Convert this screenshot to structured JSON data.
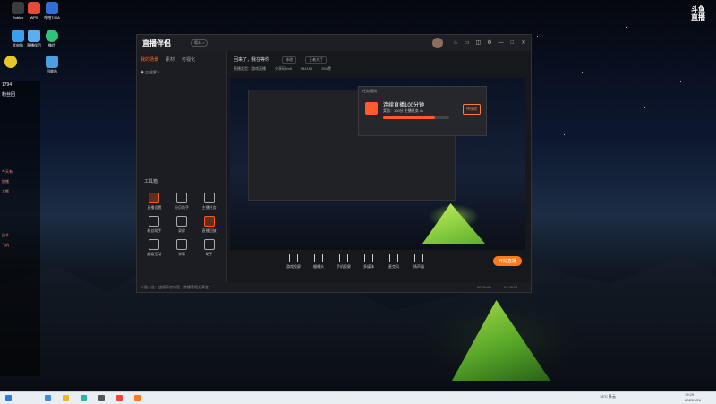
{
  "desktop": {
    "icons_left": [
      {
        "label": "Roblox"
      },
      {
        "label": "WPS"
      },
      {
        "label": "哈哈T40A"
      },
      {
        "label": "此电脑"
      },
      {
        "label": "直播伴侣"
      },
      {
        "label": ""
      },
      {
        "label": ""
      },
      {
        "label": ""
      },
      {
        "label": "微信"
      },
      {
        "label": "回收站"
      }
    ],
    "brand_corner": "斗鱼\n直播"
  },
  "chat_strip": {
    "count": "1794",
    "header": "粉丝团",
    "lines": [
      "今天有",
      "猪猪",
      "大熊",
      "白羊",
      "",
      "飞机"
    ]
  },
  "window": {
    "brand": "直播伴侣",
    "brand_tag": "版本 >",
    "titlebar_buttons": [
      "⌂",
      "▭",
      "◫",
      "⚙",
      "—",
      "□",
      "✕"
    ],
    "left_tabs": [
      "我的场景",
      "素材",
      "可视化"
    ],
    "scene_item": "全屏 1",
    "tools_title": "工具箱",
    "tools": [
      {
        "label": "直播设置",
        "red": true
      },
      {
        "label": "分贝助手",
        "red": false
      },
      {
        "label": "主播任务",
        "red": false
      },
      {
        "label": "粉丝助手",
        "red": false
      },
      {
        "label": "录屏",
        "red": false
      },
      {
        "label": "直播回放",
        "red": true
      },
      {
        "label": "超级互动",
        "red": false
      },
      {
        "label": "弹幕",
        "red": false
      },
      {
        "label": "助手",
        "red": false
      },
      {
        "label": "",
        "red": false
      },
      {
        "label": "",
        "red": false
      },
      {
        "label": "",
        "red": false
      }
    ],
    "room_name": "回来了，我在等你",
    "room_btn1": "修改",
    "room_btn2": "王者大厅",
    "meta": [
      "直播类型：游戏直播",
      "分享码:rb8",
      "984156",
      "394赞"
    ],
    "popup": {
      "header": "任务通知",
      "title": "连续直播100分钟",
      "subtitle": "奖励：100分 主播任务 x1",
      "button": "待领取",
      "progress": 0.78
    },
    "controls": [
      "游戏投屏",
      "摄像头",
      "手机投屏",
      "多媒体",
      "麦克风",
      "扬声器"
    ],
    "start_button": "开始直播",
    "status": {
      "tip": "斗鱼公告：违规不良内容，禁播等相关事宜...",
      "time1": "00:00:00",
      "time2": "02:25:01"
    }
  },
  "taskbar": {
    "tray_text": "18°C 多云",
    "clock": "19:29",
    "date": "2023/7/26"
  }
}
